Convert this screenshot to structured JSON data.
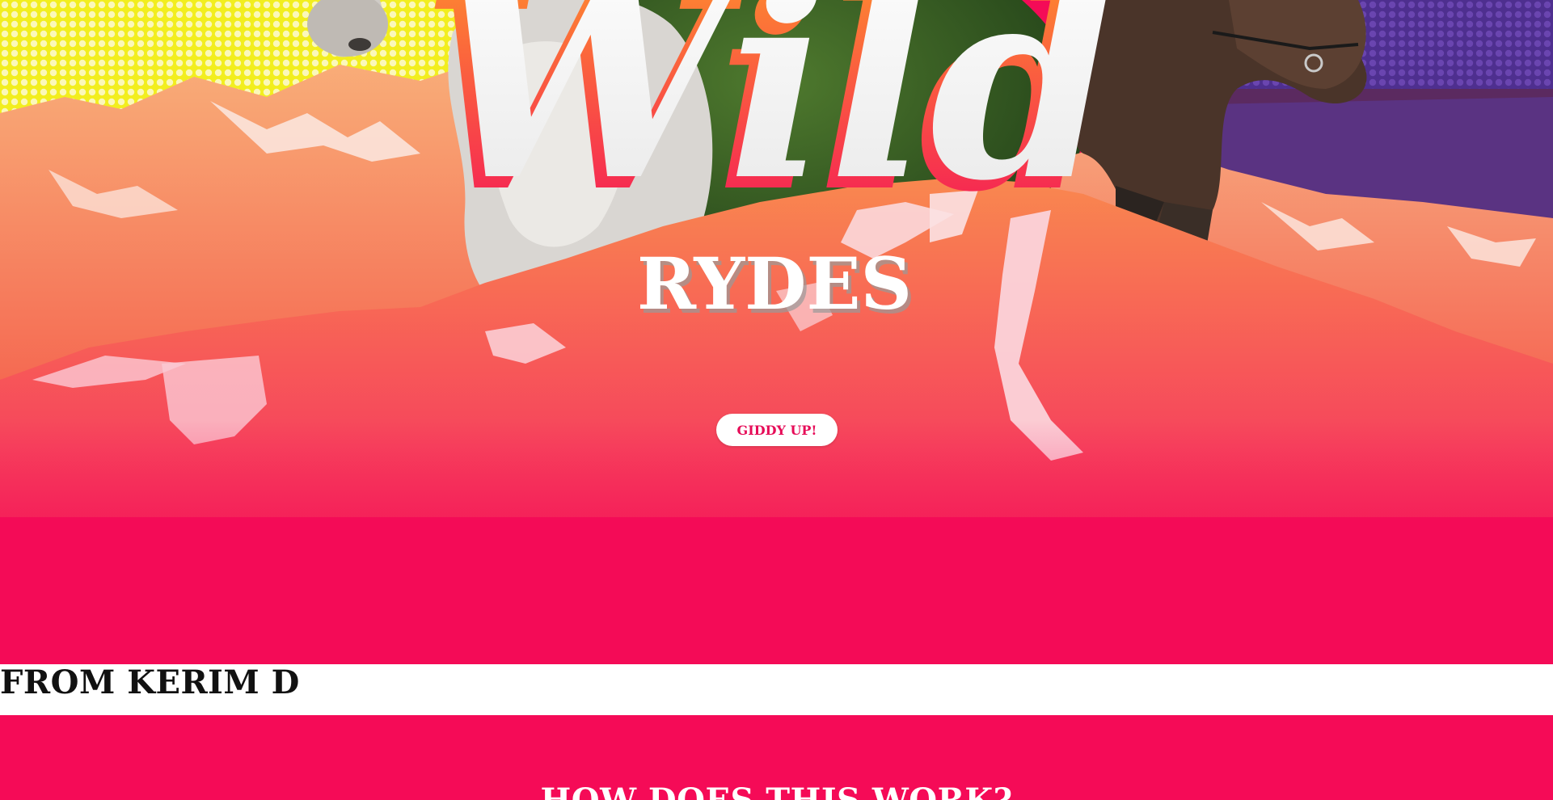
{
  "hero": {
    "logo": {
      "script_word": "Wild",
      "subtitle": "RYDES"
    },
    "cta": {
      "label": "GIDDY UP!"
    },
    "colors": {
      "brand_pink": "#f50b57",
      "cta_text": "#e60c58",
      "sky_yellow": "#f2ee1e",
      "sky_purple": "#5a3b9a"
    }
  },
  "testimonial": {
    "author_line": "FROM KERIM D"
  },
  "how_it_works": {
    "title": "HOW DOES THIS WORK?"
  }
}
